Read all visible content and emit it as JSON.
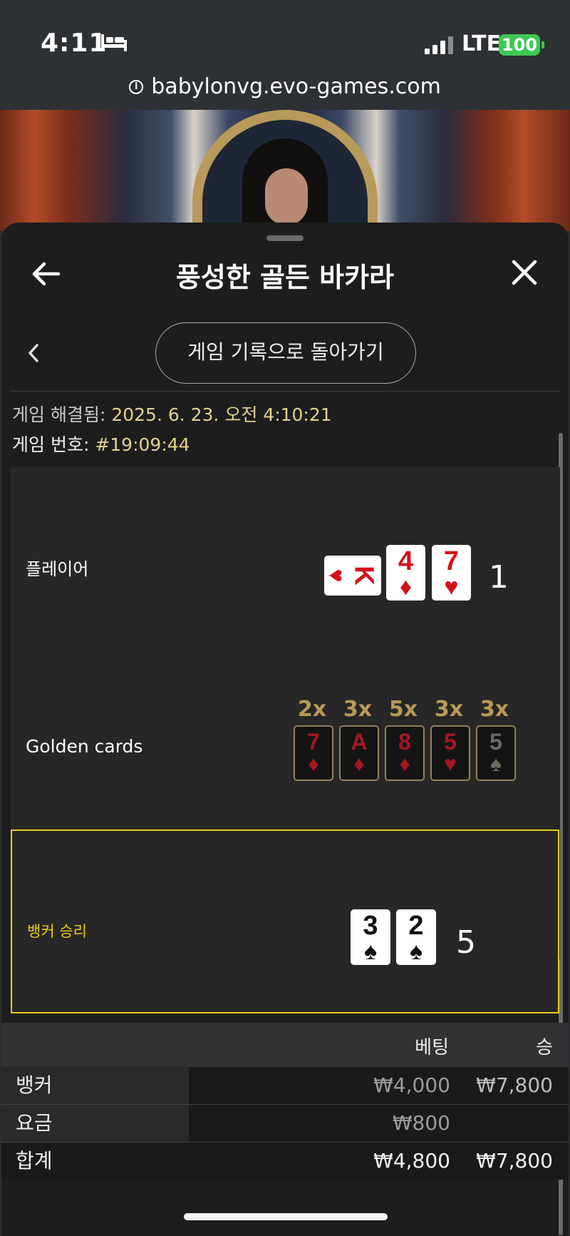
{
  "status_bar": {
    "time": "4:11",
    "network": "LTE",
    "battery": "100"
  },
  "url_bar": {
    "url": "babylonvg.evo-games.com"
  },
  "header": {
    "title": "풍성한 골든 바카라"
  },
  "nav": {
    "back_to_history": "게임 기록으로 돌아가기"
  },
  "game_info": {
    "resolved_label": "게임 해결됨: ",
    "resolved_value": "2025. 6. 23. 오전 4:10:21",
    "number_label": "게임 번호: ",
    "number_value": "#19:09:44"
  },
  "player": {
    "label": "플레이어",
    "score": "1",
    "cards": [
      {
        "rank": "K",
        "suit": "♥",
        "color": "red",
        "orientation": "sideways"
      },
      {
        "rank": "4",
        "suit": "♦",
        "color": "red"
      },
      {
        "rank": "7",
        "suit": "♥",
        "color": "red"
      }
    ]
  },
  "golden_cards": {
    "label": "Golden cards",
    "cards": [
      {
        "multiplier": "2x",
        "rank": "7",
        "suit": "♦"
      },
      {
        "multiplier": "3x",
        "rank": "A",
        "suit": "♦"
      },
      {
        "multiplier": "5x",
        "rank": "8",
        "suit": "♦"
      },
      {
        "multiplier": "3x",
        "rank": "5",
        "suit": "♥"
      },
      {
        "multiplier": "3x",
        "rank": "5",
        "suit": "♠"
      }
    ]
  },
  "banker": {
    "label": "뱅커 승리",
    "score": "5",
    "cards": [
      {
        "rank": "3",
        "suit": "♠",
        "color": "black"
      },
      {
        "rank": "2",
        "suit": "♠",
        "color": "black"
      }
    ]
  },
  "bet_table": {
    "columns": [
      "베팅",
      "승"
    ],
    "rows": [
      {
        "label": "뱅커",
        "bet": "₩4,000",
        "win": "₩7,800"
      },
      {
        "label": "요금",
        "bet": "₩800",
        "win": ""
      },
      {
        "label": "합계",
        "bet": "₩4,800",
        "win": "₩7,800"
      }
    ]
  },
  "colors": {
    "highlight": "#e7cd1f",
    "golden": "#b99a55",
    "card_red": "#d4101c",
    "battery": "#3dc952"
  },
  "icons": [
    "bed-icon",
    "signal-icon",
    "info-icon",
    "arrow-left-icon",
    "close-icon",
    "chevron-left-icon"
  ]
}
